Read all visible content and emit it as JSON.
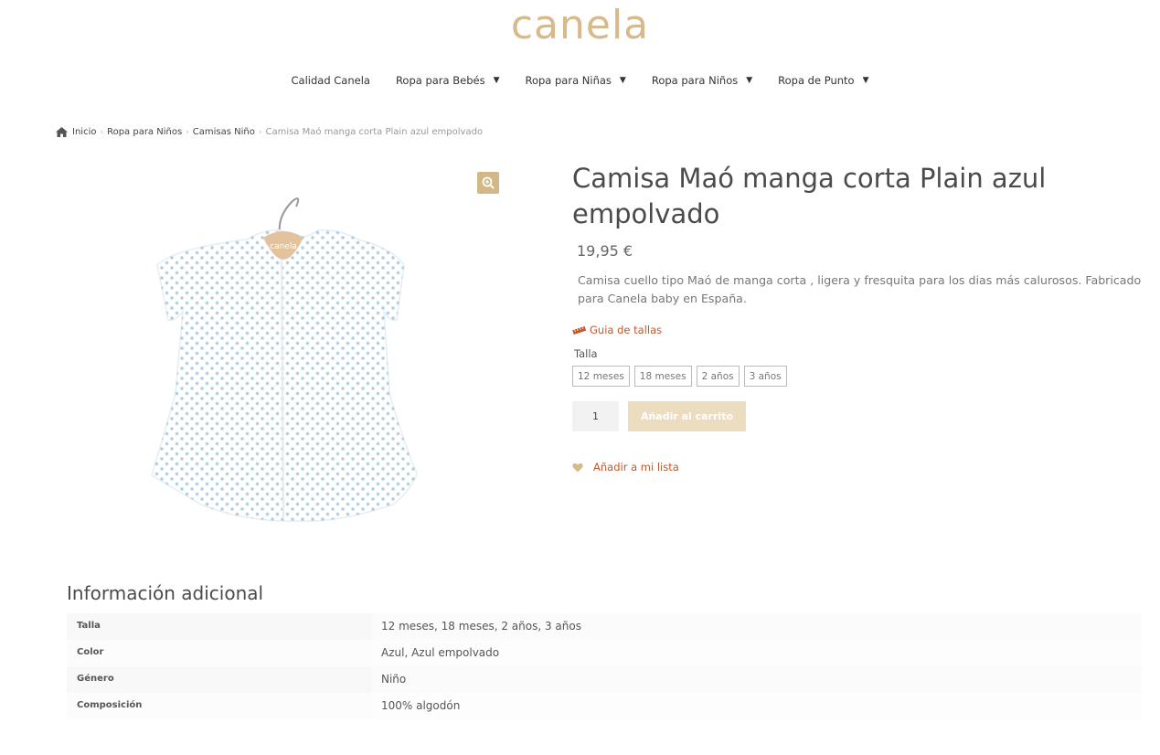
{
  "logo": "canela",
  "nav": [
    {
      "label": "Calidad Canela",
      "has_dropdown": false
    },
    {
      "label": "Ropa para Bebés",
      "has_dropdown": true
    },
    {
      "label": "Ropa para Niñas",
      "has_dropdown": true
    },
    {
      "label": "Ropa para Niños",
      "has_dropdown": true
    },
    {
      "label": "Ropa de Punto",
      "has_dropdown": true
    }
  ],
  "breadcrumb": {
    "home": "Inicio",
    "links": [
      "Ropa para Niños",
      "Camisas Niño"
    ],
    "current": "Camisa Maó manga corta Plain azul empolvado",
    "separator": "›"
  },
  "product": {
    "title": "Camisa Maó manga corta Plain azul empolvado",
    "price": "19,95 €",
    "description": "Camisa cuello tipo Maó de manga corta , ligera y fresquita para los dias más calurosos. Fabricado para Canela baby en España.",
    "size_guide": "Guia de tallas",
    "variant_label": "Talla",
    "variants": [
      "12 meses",
      "18 meses",
      "2 años",
      "3 años"
    ],
    "quantity": "1",
    "add_to_cart": "Añadir al carrito",
    "wishlist": "Añadir a mi lista",
    "hanger_tag": "canela"
  },
  "additional_info": {
    "title": "Información adicional",
    "rows": [
      {
        "label": "Talla",
        "value": "12 meses, 18 meses, 2 años, 3 años"
      },
      {
        "label": "Color",
        "value": "Azul, Azul empolvado"
      },
      {
        "label": "Género",
        "value": "Niño"
      },
      {
        "label": "Composición",
        "value": "100% algodón"
      }
    ]
  },
  "colors": {
    "brand": "#d8b98a",
    "accent_link": "#c0582a",
    "button_disabled": "#ecdcc0",
    "dots": "#8fb8d4"
  }
}
